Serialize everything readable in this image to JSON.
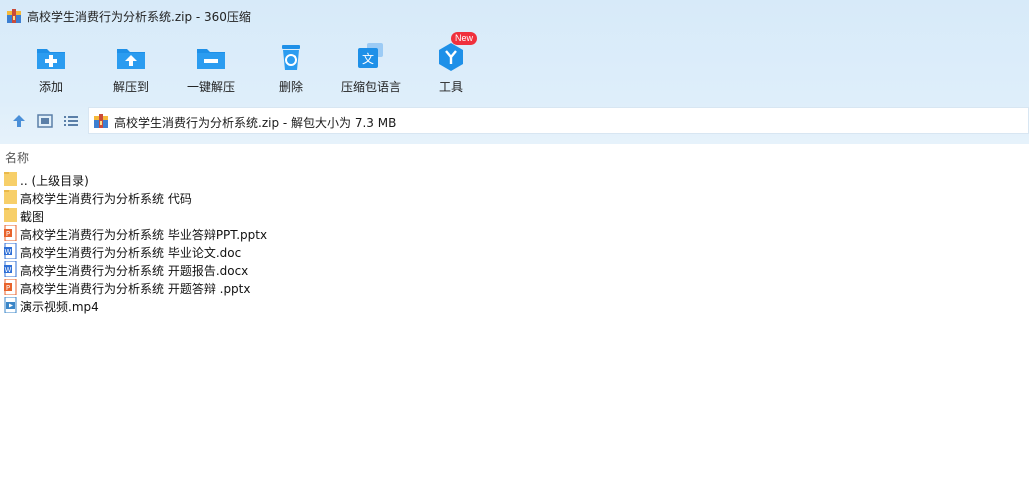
{
  "window": {
    "title": "高校学生消费行为分析系统.zip - 360压缩"
  },
  "toolbar": {
    "items": [
      {
        "label": "添加",
        "icon": "add-icon"
      },
      {
        "label": "解压到",
        "icon": "extract-to-icon"
      },
      {
        "label": "一键解压",
        "icon": "one-click-extract-icon"
      },
      {
        "label": "删除",
        "icon": "delete-icon"
      },
      {
        "label": "压缩包语言",
        "icon": "archive-language-icon"
      },
      {
        "label": "工具",
        "icon": "tools-icon",
        "badge": "New"
      }
    ]
  },
  "address": {
    "path": "高校学生消费行为分析系统.zip - 解包大小为 7.3 MB"
  },
  "list": {
    "column_name": "名称",
    "files": [
      {
        "name": ".. (上级目录)",
        "type": "folder"
      },
      {
        "name": "高校学生消费行为分析系统 代码",
        "type": "folder"
      },
      {
        "name": "截图",
        "type": "folder"
      },
      {
        "name": "高校学生消费行为分析系统 毕业答辩PPT.pptx",
        "type": "pptx"
      },
      {
        "name": "高校学生消费行为分析系统 毕业论文.doc",
        "type": "doc"
      },
      {
        "name": "高校学生消费行为分析系统 开题报告.docx",
        "type": "doc"
      },
      {
        "name": "高校学生消费行为分析系统 开题答辩 .pptx",
        "type": "pptx"
      },
      {
        "name": "演示视频.mp4",
        "type": "video"
      }
    ]
  },
  "colors": {
    "accent": "#1e90e8",
    "badge": "#f0303c",
    "folder": "#f7cf69",
    "pptx": "#e8632b",
    "doc": "#2f6fd6"
  }
}
